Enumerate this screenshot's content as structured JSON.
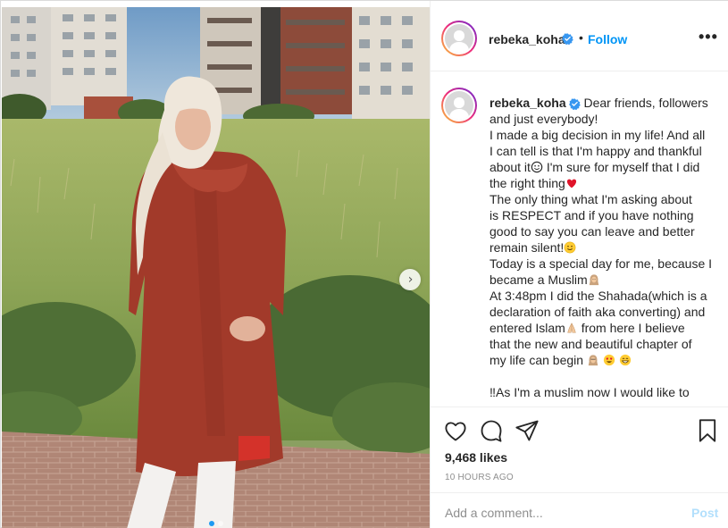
{
  "post": {
    "username": "rebeka_koha",
    "verified": true,
    "separator": "•",
    "follow_label": "Follow",
    "more_label": "•••",
    "photo_alt": "",
    "carousel_dot_count": 2,
    "carousel_active_dot": 0
  },
  "caption": {
    "username": "rebeka_koha",
    "first_line": " Dear friends, followers",
    "lines": [
      "and just everybody!",
      "I made a big decision in my life! And all",
      "I can tell is that I'm happy and thankful",
      "about it",
      " I'm sure for myself that I did",
      "the right thing",
      "The only thing what I'm asking about",
      "is RESPECT and if you have nothing",
      "good to say you can leave and better",
      "remain silent!",
      "Today is a special day for me, because I",
      "became a Muslim",
      "At 3:48pm I did the Shahada(which is a",
      "declaration of faith aka converting) and",
      "entered Islam",
      " from here I believe",
      "that the new and beautiful chapter of",
      "my life can begin",
      "",
      "‼As I'm a muslim now I would like to"
    ]
  },
  "actions": {
    "likes": "9,468 likes",
    "time_ago": "10 HOURS AGO"
  },
  "comment": {
    "placeholder": "Add a comment...",
    "post_label": "Post"
  },
  "colors": {
    "accent": "#0095f6",
    "verified": "#3897f0",
    "post_disabled": "#b2dffc"
  },
  "icons": {
    "like": "heart-icon",
    "comment": "comment-icon",
    "share": "paper-plane-icon",
    "save": "bookmark-icon",
    "next": "chevron-right-icon",
    "verified": "verified-badge-icon"
  }
}
